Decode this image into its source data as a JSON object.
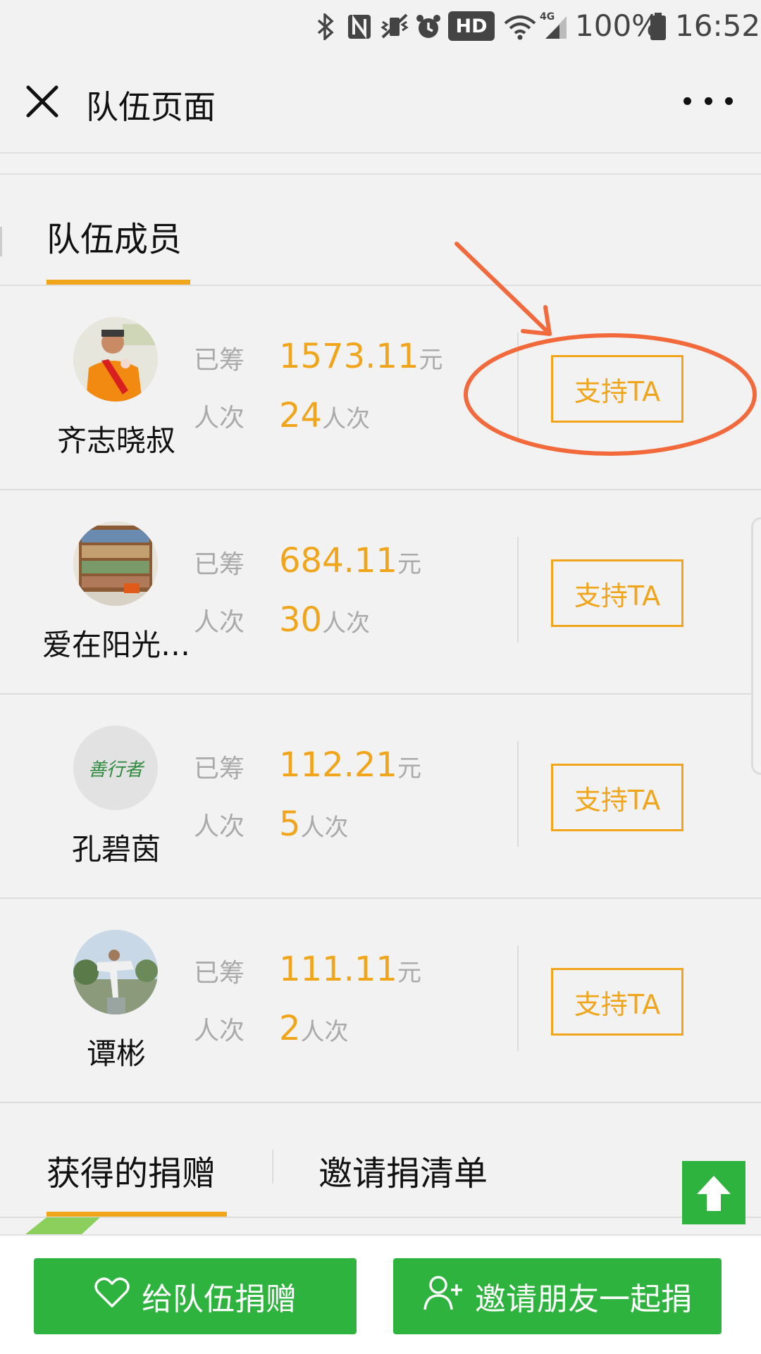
{
  "status_bar": {
    "icons": [
      "bluetooth-icon",
      "nfc-icon",
      "vibrate-icon",
      "alarm-icon",
      "wifi-icon",
      "signal-4g-icon",
      "battery-icon"
    ],
    "hd": "HD",
    "network": "4G",
    "battery": "100%",
    "time": "16:52"
  },
  "nav": {
    "title": "队伍页面"
  },
  "members": {
    "tab_label": "队伍成员",
    "raised_label": "已筹",
    "count_label": "人次",
    "currency_unit": "元",
    "count_unit": "人次",
    "support_label": "支持TA",
    "items": [
      {
        "name": "齐志晓叔",
        "raised": "1573.11",
        "count": "24"
      },
      {
        "name": "爱在阳光…",
        "raised": "684.11",
        "count": "30"
      },
      {
        "name": "孔碧茵",
        "raised": "112.21",
        "count": "5"
      },
      {
        "name": "谭彬",
        "raised": "111.11",
        "count": "2"
      }
    ],
    "avatar_3_text": "善行者"
  },
  "tabs": {
    "donations": "获得的捐赠",
    "invite_list": "邀请捐清单"
  },
  "bottom": {
    "donate_label": "给队伍捐赠",
    "invite_label": "邀请朋友一起捐"
  },
  "colors": {
    "accent": "#f0a51a",
    "green": "#2eb33e",
    "annotation": "#f26a3b",
    "background": "#f2f2f2"
  }
}
